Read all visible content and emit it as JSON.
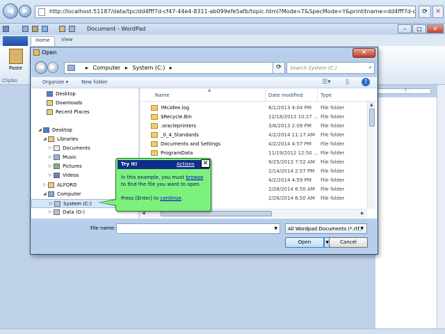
{
  "browser": {
    "url": "http://localhost:51187/data/tpc/dd4fff7d-cf47-44e4-8311-ab099efe5afb/topic.html?Mode=T&SpecMode=Y&printitname=dd4fff7d-cf47-44e4-8311-ab099efe5afb"
  },
  "wordpad": {
    "title": "Document - WordPad",
    "tabs": [
      "Home",
      "View"
    ],
    "paste_label": "Paste",
    "clipboard_label": "Clipbo",
    "ruler_text": "· 7 ·"
  },
  "dialog": {
    "title": "Open",
    "close_label": "✕",
    "breadcrumb": [
      "Computer",
      "System (C:)"
    ],
    "search_placeholder": "Search System (C:)",
    "toolbar": {
      "organize": "Organize ▾",
      "new_folder": "New folder"
    },
    "nav": [
      {
        "label": "Desktop"
      },
      {
        "label": "Downloads"
      },
      {
        "label": "Recent Places"
      },
      {
        "label": "Desktop"
      },
      {
        "label": "Libraries"
      },
      {
        "label": "Documents"
      },
      {
        "label": "Music"
      },
      {
        "label": "Pictures"
      },
      {
        "label": "Videos"
      },
      {
        "label": "ALFORD"
      },
      {
        "label": "Computer"
      },
      {
        "label": "System (C:)"
      },
      {
        "label": "Data (D:)"
      }
    ],
    "columns": {
      "name": "Name",
      "date": "Date modified",
      "type": "Type"
    },
    "files": [
      {
        "name": "!McAfee.log",
        "date": "8/1/2013 4:04 PM",
        "type": "File folder"
      },
      {
        "name": "$Recycle.Bin",
        "date": "12/18/2013 10:27 ...",
        "type": "File folder"
      },
      {
        "name": ".oracleprinters",
        "date": "3/8/2013 2:09 PM",
        "type": "File folder"
      },
      {
        "name": "_0_4_Standards",
        "date": "4/2/2014 11:17 AM",
        "type": "File folder"
      },
      {
        "name": "Documents and Settings",
        "date": "4/2/2014 4:57 PM",
        "type": "File folder"
      },
      {
        "name": "ProgramData",
        "date": "11/19/2012 12:50 ...",
        "type": "File folder"
      },
      {
        "name": "",
        "date": "9/25/2013 7:52 AM",
        "type": "File folder"
      },
      {
        "name": "",
        "date": "2/14/2014 2:57 PM",
        "type": "File folder"
      },
      {
        "name": "",
        "date": "4/2/2014 4:59 PM",
        "type": "File folder"
      },
      {
        "name": "mation",
        "date": "2/28/2014 6:50 AM",
        "type": "File folder"
      },
      {
        "name": "",
        "date": "2/28/2014 6:50 AM",
        "type": "File folder"
      }
    ],
    "filename_label": "File name:",
    "filename_value": "",
    "filetype": "All Wordpad Documents (*.rtf,",
    "open_label": "Open",
    "cancel_label": "Cancel"
  },
  "callout": {
    "title": "Try It!",
    "actions": "Actions",
    "close": "✕",
    "line1_pre": "In this example, you must ",
    "line1_link": "browse",
    "line1_post": " to find the file you want to open.",
    "line2_pre": "Press [Enter] to ",
    "line2_link": "continue",
    "line2_post": "."
  },
  "colors": {
    "callout_bg": "#7cf27c",
    "callout_header": "#0f2e8a",
    "dialog_close": "#c23a24"
  },
  "icons": [
    "back-icon",
    "forward-icon",
    "refresh-icon",
    "search-icon",
    "folder-icon",
    "drive-icon",
    "close-icon"
  ]
}
